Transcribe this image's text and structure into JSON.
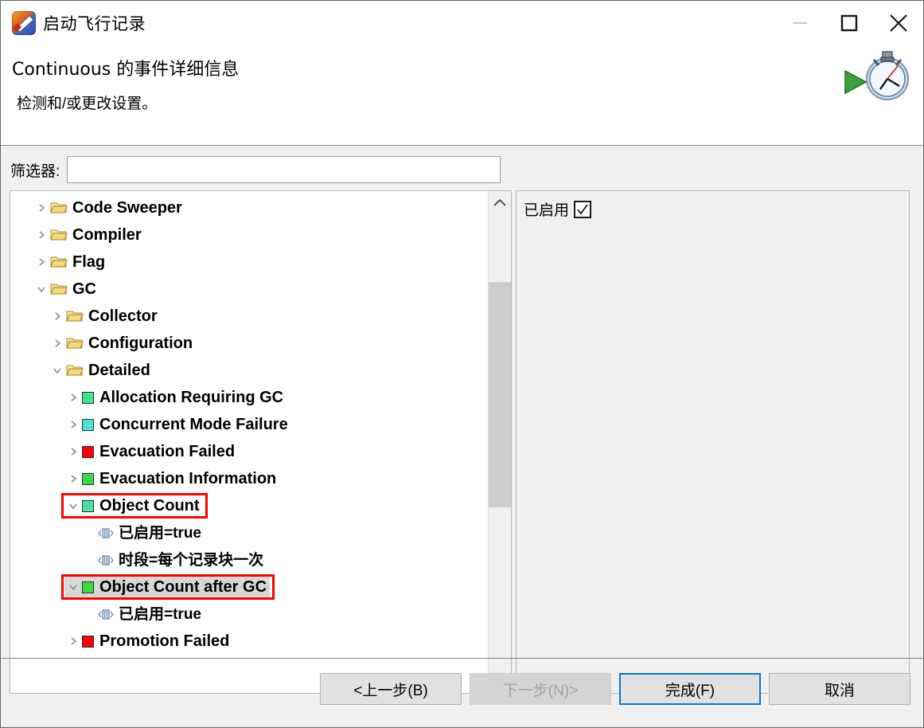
{
  "window": {
    "title": "启动飞行记录",
    "icon": "flight-recorder-icon",
    "controls": {
      "minimize": "minimize-icon",
      "maximize": "maximize-icon",
      "close": "close-icon"
    }
  },
  "header": {
    "title": "Continuous 的事件详细信息",
    "subtitle": "检测和/或更改设置。",
    "image": "stopwatch-play-icon"
  },
  "filter": {
    "label": "筛选器:",
    "value": "",
    "placeholder": ""
  },
  "tree": {
    "rows": [
      {
        "label": "Code Sweeper",
        "indent": 0,
        "twisty": "collapsed",
        "icon": "folder",
        "color": ""
      },
      {
        "label": "Compiler",
        "indent": 0,
        "twisty": "collapsed",
        "icon": "folder",
        "color": ""
      },
      {
        "label": "Flag",
        "indent": 0,
        "twisty": "collapsed",
        "icon": "folder",
        "color": ""
      },
      {
        "label": "GC",
        "indent": 0,
        "twisty": "expanded",
        "icon": "folder",
        "color": ""
      },
      {
        "label": "Collector",
        "indent": 1,
        "twisty": "collapsed",
        "icon": "folder",
        "color": ""
      },
      {
        "label": "Configuration",
        "indent": 1,
        "twisty": "collapsed",
        "icon": "folder",
        "color": ""
      },
      {
        "label": "Detailed",
        "indent": 1,
        "twisty": "expanded",
        "icon": "folder",
        "color": ""
      },
      {
        "label": "Allocation Requiring GC",
        "indent": 2,
        "twisty": "collapsed",
        "icon": "square",
        "color": "#3fe28f"
      },
      {
        "label": "Concurrent Mode Failure",
        "indent": 2,
        "twisty": "collapsed",
        "icon": "square",
        "color": "#4fe0d8"
      },
      {
        "label": "Evacuation Failed",
        "indent": 2,
        "twisty": "collapsed",
        "icon": "square",
        "color": "#ff0000"
      },
      {
        "label": "Evacuation Information",
        "indent": 2,
        "twisty": "collapsed",
        "icon": "square",
        "color": "#3ad94a"
      },
      {
        "label": "Object Count",
        "indent": 2,
        "twisty": "expanded",
        "icon": "square",
        "color": "#46e0a0",
        "annotated": true
      },
      {
        "label": "已启用=true",
        "indent": 3,
        "twisty": "none",
        "icon": "property",
        "color": ""
      },
      {
        "label": "时段=每个记录块一次",
        "indent": 3,
        "twisty": "none",
        "icon": "property",
        "color": ""
      },
      {
        "label": "Object Count after GC",
        "indent": 2,
        "twisty": "expanded",
        "icon": "square",
        "color": "#3ade3a",
        "annotated": true,
        "selected": true
      },
      {
        "label": "已启用=true",
        "indent": 3,
        "twisty": "none",
        "icon": "property",
        "color": ""
      },
      {
        "label": "Promotion Failed",
        "indent": 2,
        "twisty": "collapsed",
        "icon": "square",
        "color": "#ff0000"
      }
    ]
  },
  "scrollbar": {
    "up": "chevron-up-icon",
    "down": "chevron-down-icon"
  },
  "detail": {
    "enabled_label": "已启用",
    "enabled_checked": true
  },
  "buttons": {
    "back": "<上一步(B)",
    "next": "下一步(N)>",
    "finish": "完成(F)",
    "cancel": "取消"
  },
  "colors": {
    "annotation": "#ff0000",
    "focus": "#0078d7",
    "selection": "#d7d7d7",
    "panel_bg": "#f0f0f0"
  }
}
